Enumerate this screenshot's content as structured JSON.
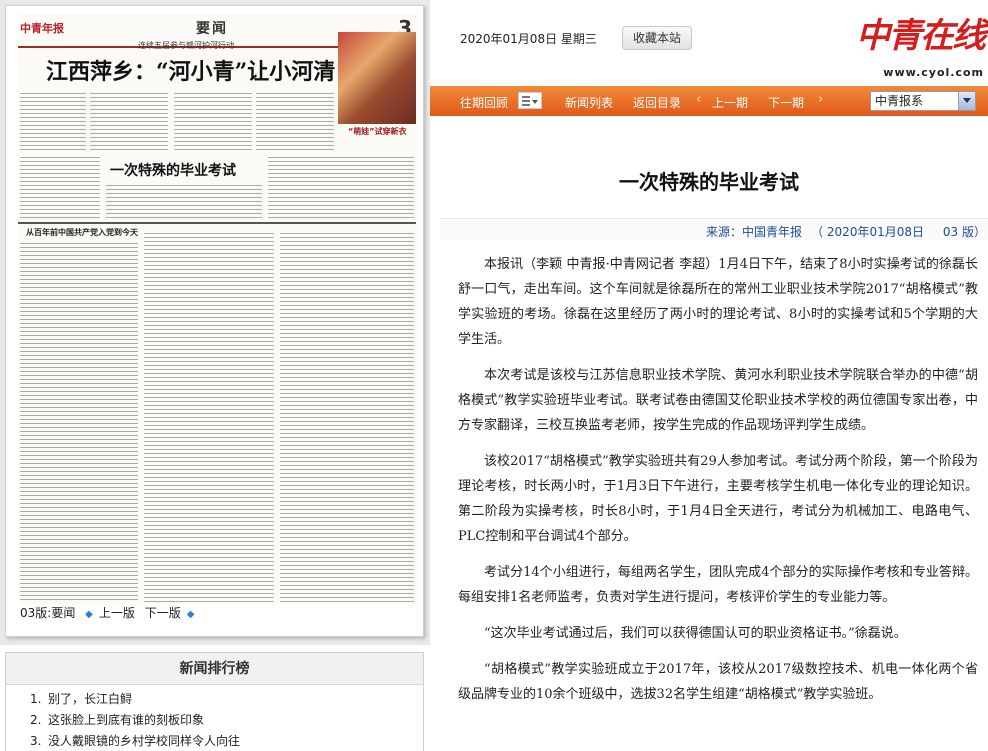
{
  "header": {
    "date": "2020年01月08日 星期三",
    "favorite_button": "收藏本站",
    "logo_text": "中青在线",
    "logo_url": "www.cyol.com"
  },
  "navbar": {
    "past_review": "往期回顾",
    "news_list": "新闻列表",
    "back_to_toc": "返回目录",
    "prev_page": "上一期",
    "next_page": "下一期",
    "paper_select": "中青报系"
  },
  "paper_preview": {
    "section": "要闻",
    "page_num": "3",
    "logo": "中青年报",
    "subheadline": "连续五届参与赣河护河行动",
    "headline": "江西萍乡：“河小青”让小河清",
    "photo_caption": "“萌娃”试穿新衣",
    "second_headline": "一次特殊的毕业考试",
    "side_headline": "从百年前中国共产党入党到今天"
  },
  "paper_nav": {
    "current_page": "03版:要闻",
    "prev_page": "上一版",
    "next_page": "下一版"
  },
  "ranking": {
    "title": "新闻排行榜",
    "items": [
      {
        "num": "1.",
        "text": "别了，长江白鲟"
      },
      {
        "num": "2.",
        "text": "这张脸上到底有谁的刻板印象"
      },
      {
        "num": "3.",
        "text": "没人戴眼镜的乡村学校同样令人向往"
      }
    ]
  },
  "article": {
    "title": "一次特殊的毕业考试",
    "source": "来源：中国青年报",
    "date": "（ 2020年01月08日",
    "page": "03 版）",
    "paragraphs": [
      "本报讯（李颖 中青报·中青网记者 李超）1月4日下午，结束了8小时实操考试的徐磊长舒一口气，走出车间。这个车间就是徐磊所在的常州工业职业技术学院2017“胡格模式”教学实验班的考场。徐磊在这里经历了两小时的理论考试、8小时的实操考试和5个学期的大学生活。",
      "本次考试是该校与江苏信息职业技术学院、黄河水利职业技术学院联合举办的中德“胡格模式”教学实验班毕业考试。联考试卷由德国艾伦职业技术学校的两位德国专家出卷，中方专家翻译，三校互换监考老师，按学生完成的作品现场评判学生成绩。",
      "该校2017“胡格模式”教学实验班共有29人参加考试。考试分两个阶段，第一个阶段为理论考核，时长两小时，于1月3日下午进行，主要考核学生机电一体化专业的理论知识。第二阶段为实操考核，时长8小时，于1月4日全天进行，考试分为机械加工、电路电气、PLC控制和平台调试4个部分。",
      "考试分14个小组进行，每组两名学生，团队完成4个部分的实际操作考核和专业答辩。每组安排1名老师监考，负责对学生进行提问，考核评价学生的专业能力等。",
      "“这次毕业考试通过后，我们可以获得德国认可的职业资格证书。”徐磊说。",
      "“胡格模式”教学实验班成立于2017年，该校从2017级数控技术、机电一体化两个省级品牌专业的10余个班级中，选拔32名学生组建“胡格模式”教学实验班。"
    ]
  }
}
